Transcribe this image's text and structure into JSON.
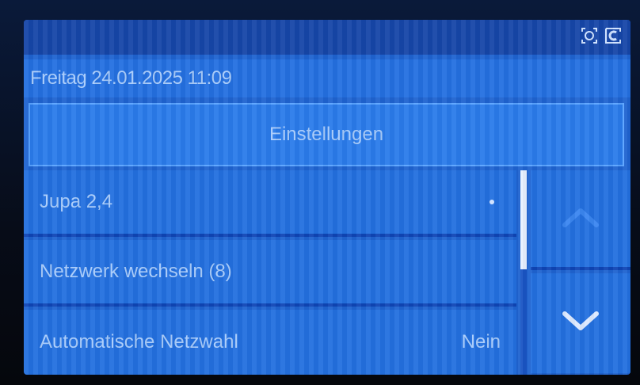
{
  "status_icons": [
    "camera-target-icon",
    "c-mode-icon"
  ],
  "header": {
    "datetime": "Freitag 24.01.2025 11:09"
  },
  "title": "Einstellungen",
  "list": {
    "items": [
      {
        "label": "Jupa 2,4",
        "value": "",
        "selected_marker": true
      },
      {
        "label": "Netzwerk wechseln (8)",
        "value": ""
      },
      {
        "label": "Automatische Netzwahl",
        "value": "Nein"
      }
    ]
  },
  "colors": {
    "screen_bg": "#1f63d0",
    "text": "#a9ccfb",
    "accent_border": "#5aa3ff"
  }
}
